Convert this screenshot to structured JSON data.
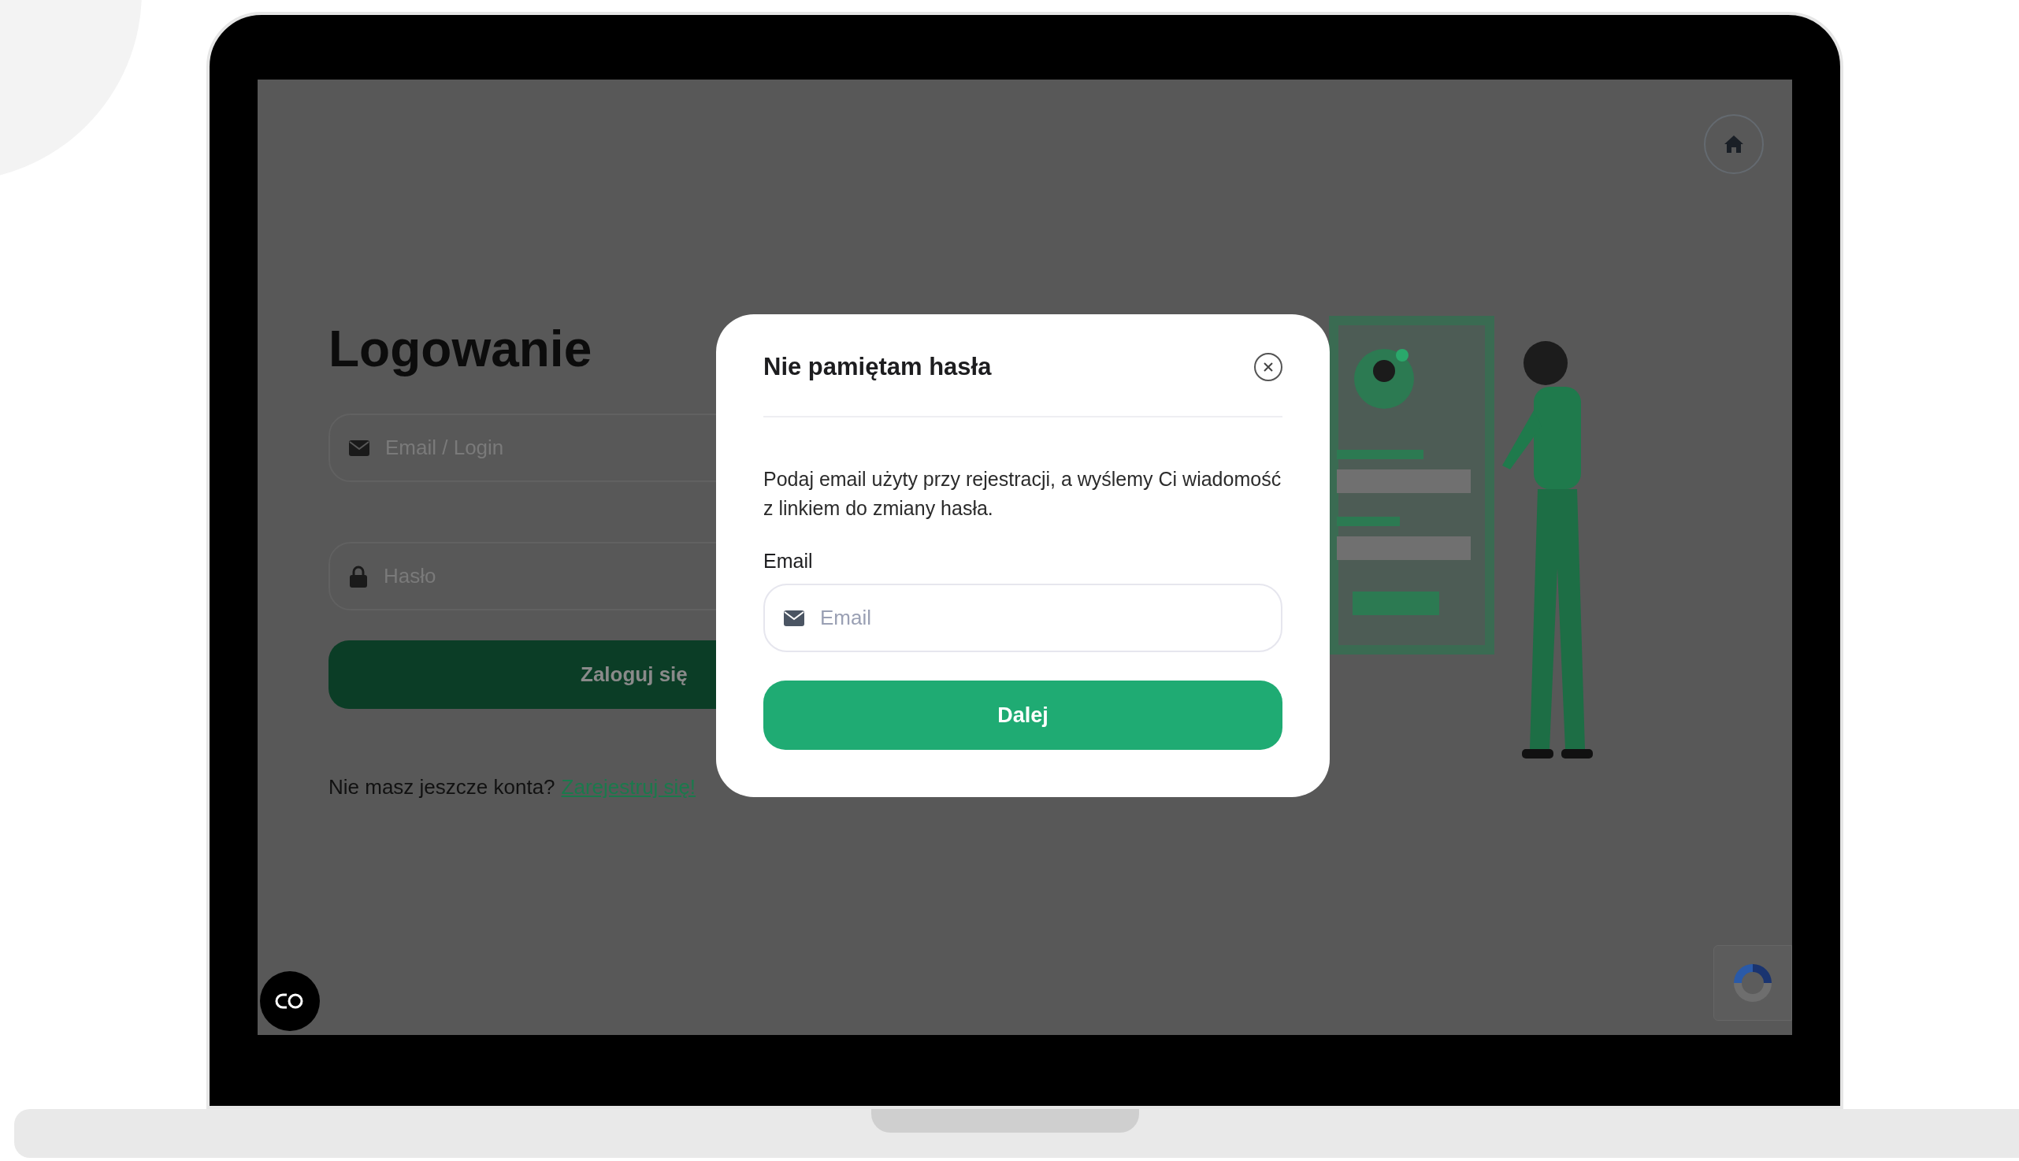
{
  "login": {
    "title": "Logowanie",
    "email_placeholder": "Email / Login",
    "password_placeholder": "Hasło",
    "submit": "Zaloguj się",
    "no_account": "Nie masz jeszcze konta?",
    "register_link": "Zarejestruj się!"
  },
  "modal": {
    "title": "Nie pamiętam hasła",
    "description": "Podaj email użyty przy rejestracji, a wyślemy Ci wiadomość z linkiem do zmiany hasła.",
    "email_label": "Email",
    "email_placeholder": "Email",
    "submit": "Dalej"
  }
}
